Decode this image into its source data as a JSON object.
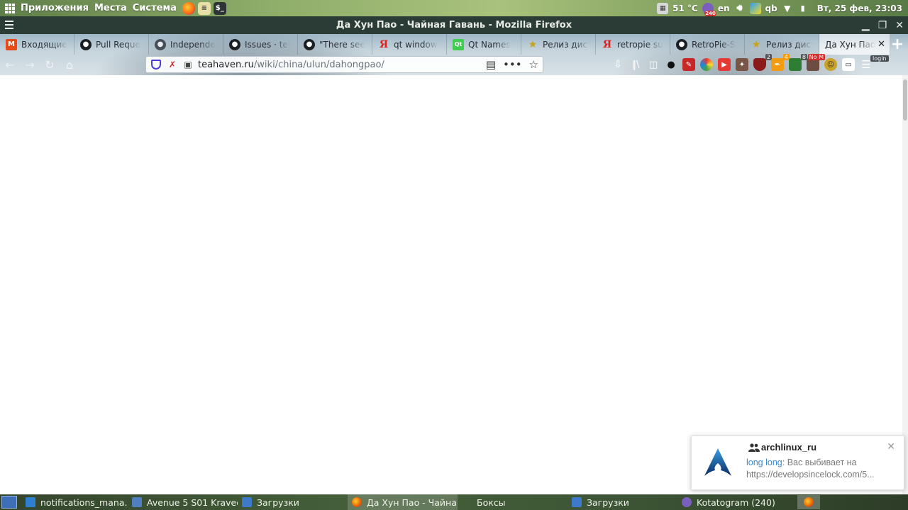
{
  "top_panel": {
    "menus": [
      "Приложения",
      "Места",
      "Система"
    ],
    "temperature": "51 °C",
    "vpn_badge": "240",
    "keyboard_layout": "en",
    "tray_qb": "qb",
    "clock": "Вт, 25 фев, 23:03"
  },
  "window": {
    "title": "Да Хун Пао - Чайная Гавань - Mozilla Firefox"
  },
  "tabs": [
    {
      "label": "Входящие",
      "icon": "mail-icon"
    },
    {
      "label": "Pull Reque",
      "icon": "github-icon"
    },
    {
      "label": "Independe",
      "icon": "github-muted-icon"
    },
    {
      "label": "Issues · tel",
      "icon": "github-icon"
    },
    {
      "label": "\"There see",
      "icon": "github-icon"
    },
    {
      "label": "qt window",
      "icon": "yandex-icon"
    },
    {
      "label": "Qt Names",
      "icon": "qt-icon"
    },
    {
      "label": "Релиз дист",
      "icon": "star-icon"
    },
    {
      "label": "retropie su",
      "icon": "yandex-icon"
    },
    {
      "label": "RetroPie-S",
      "icon": "github-icon"
    },
    {
      "label": "Релиз дист",
      "icon": "star-icon"
    },
    {
      "label": "Да Хун Пао",
      "icon": "",
      "active": true
    }
  ],
  "urlbar": {
    "host": "teahaven.ru",
    "path": "/wiki/china/ulun/dahongpao/"
  },
  "extensions": {
    "badge_1": "2",
    "badge_2": "4",
    "badge_3": "8",
    "badge_4": "No M",
    "login_tag": "login"
  },
  "notification": {
    "chat": "archlinux_ru",
    "sender": "long long",
    "message": "Вас выбивает на",
    "link": "https://developsincelock.com/5..."
  },
  "taskbar": {
    "tasks": [
      {
        "label": "notifications_mana...",
        "icon_color": "#2f7fd1"
      },
      {
        "label": "Avenue 5 S01 Kravec",
        "icon_color": "#4f7fbf"
      },
      {
        "label": "Загрузки",
        "icon_color": "#3f79c9"
      },
      {
        "label": "Да Хун Пао - Чайна...",
        "icon_color": "#e66000",
        "active": true
      },
      {
        "label": "Боксы",
        "icon_color": ""
      },
      {
        "label": "Загрузки",
        "icon_color": "#3f79c9"
      },
      {
        "label": "Kotatogram (240)",
        "icon_color": "#7b5fbf"
      }
    ]
  },
  "colors": {
    "notif_sender": "#3a8bd0",
    "titlebar_bg": "#2b3b35",
    "shield": "#4a3ddb"
  }
}
